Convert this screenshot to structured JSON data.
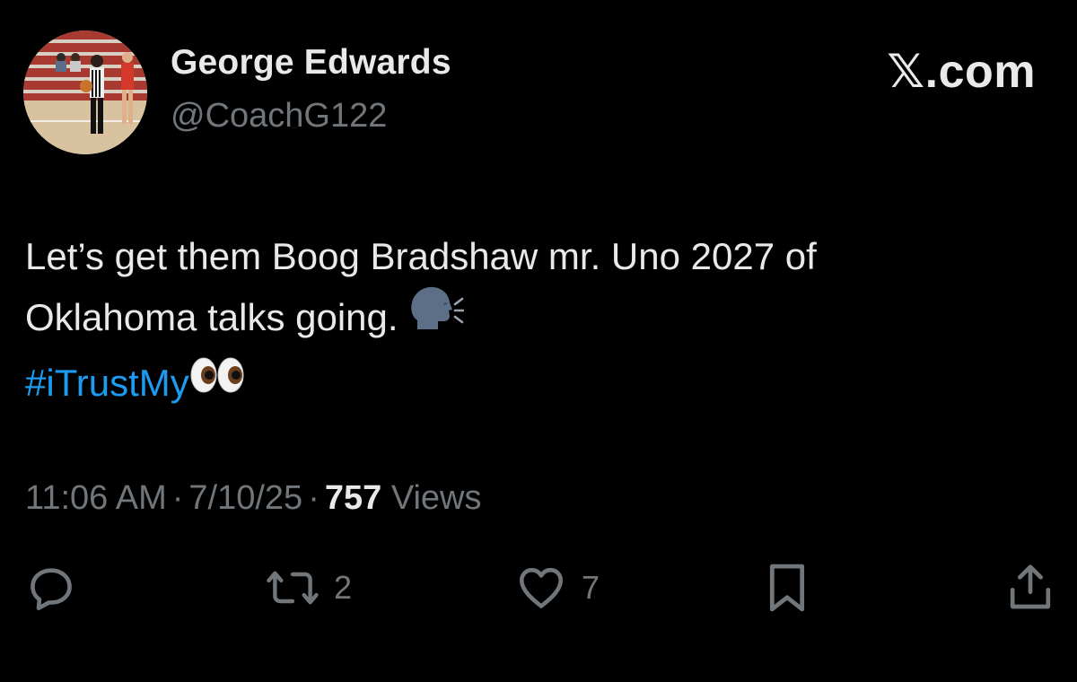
{
  "author": {
    "name": "George Edwards",
    "handle": "@CoachG122"
  },
  "brand": "𝕏.com",
  "tweet": {
    "line1": "Let’s get them Boog Bradshaw mr. Uno 2027 of",
    "line2": "Oklahoma talks going.",
    "hashtag": "#iTrustMy",
    "emoji_after_line2": "speaking-head-emoji",
    "emoji_after_hashtag": "eyes-emoji"
  },
  "meta": {
    "time": "11:06 AM",
    "separator": "·",
    "date": "7/10/25",
    "views_count": "757",
    "views_label": "Views"
  },
  "actions": {
    "retweets": "2",
    "likes": "7"
  },
  "colors": {
    "background": "#000000",
    "text": "#e7e9ea",
    "secondary": "#71767b",
    "link": "#1d9bf0"
  }
}
